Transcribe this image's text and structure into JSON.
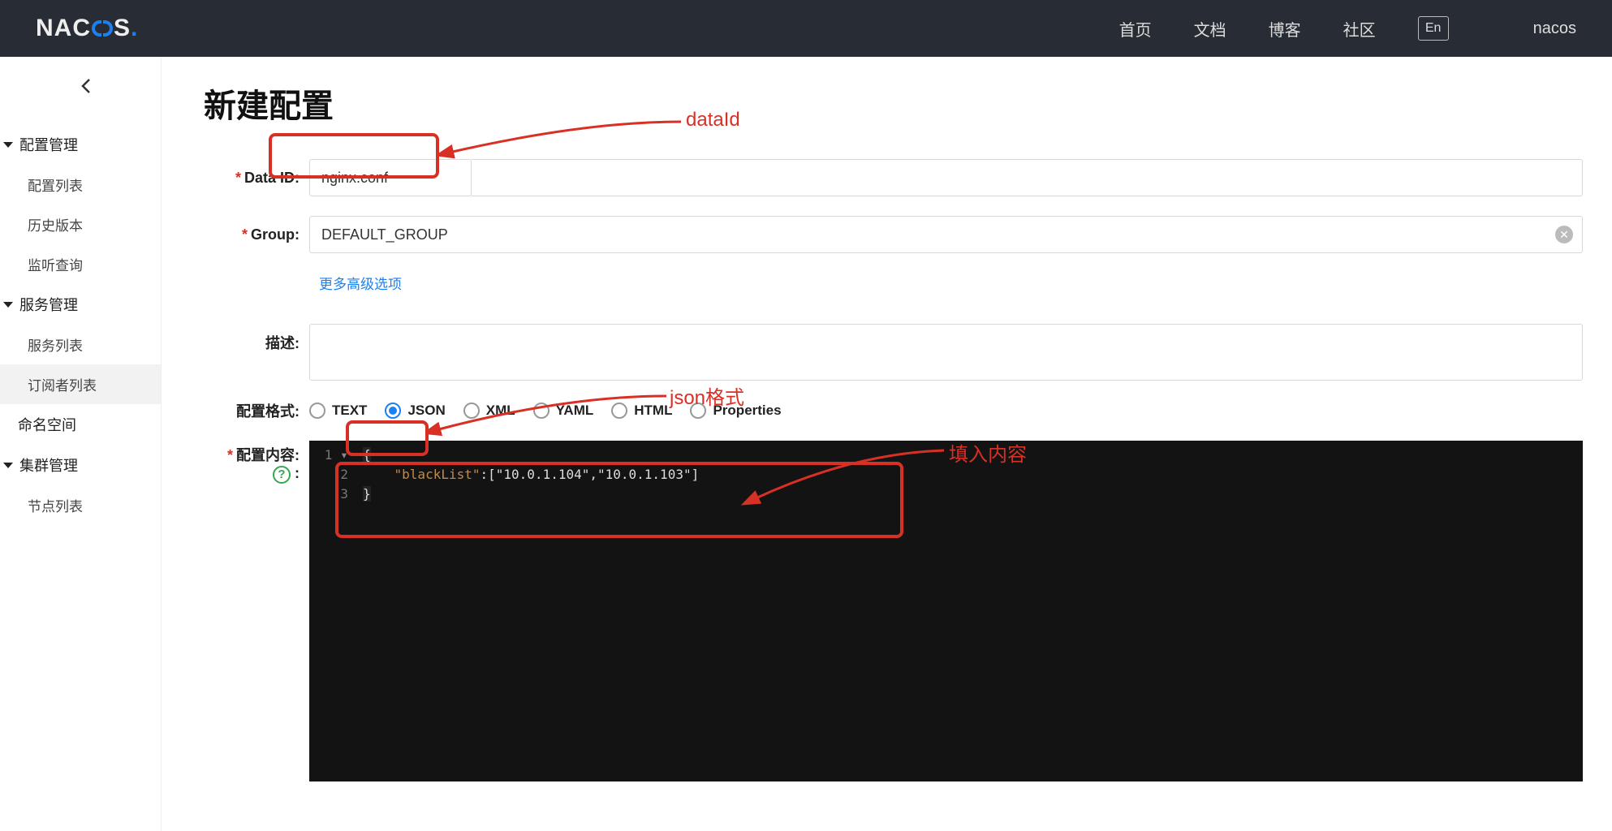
{
  "topbar": {
    "logo_pre": "NAC",
    "logo_mid": "O",
    "logo_post": "S",
    "nav": {
      "home": "首页",
      "docs": "文档",
      "blog": "博客",
      "community": "社区"
    },
    "lang": "En",
    "user": "nacos"
  },
  "sidebar": {
    "groups": [
      {
        "title": "配置管理",
        "items": [
          "配置列表",
          "历史版本",
          "监听查询"
        ]
      },
      {
        "title": "服务管理",
        "items": [
          "服务列表",
          "订阅者列表"
        ]
      }
    ],
    "standalone": "命名空间",
    "cluster": {
      "title": "集群管理",
      "items": [
        "节点列表"
      ]
    }
  },
  "page": {
    "title": "新建配置",
    "labels": {
      "dataId": "Data ID:",
      "group": "Group:",
      "moreOpt": "更多高级选项",
      "desc": "描述:",
      "format": "配置格式:",
      "content": "配置内容:"
    },
    "form": {
      "dataId": "nginx.conf",
      "group": "DEFAULT_GROUP",
      "formats": [
        "TEXT",
        "JSON",
        "XML",
        "YAML",
        "HTML",
        "Properties"
      ],
      "selectedFormat": "JSON"
    },
    "code": {
      "line1_open": "{",
      "line2_key": "\"blackList\"",
      "line2_rest": ":[\"10.0.1.104\",\"10.0.1.103\"]",
      "line3_close": "}"
    }
  },
  "annotations": {
    "a1": "dataId",
    "a2": "json格式",
    "a3": "填入内容"
  }
}
